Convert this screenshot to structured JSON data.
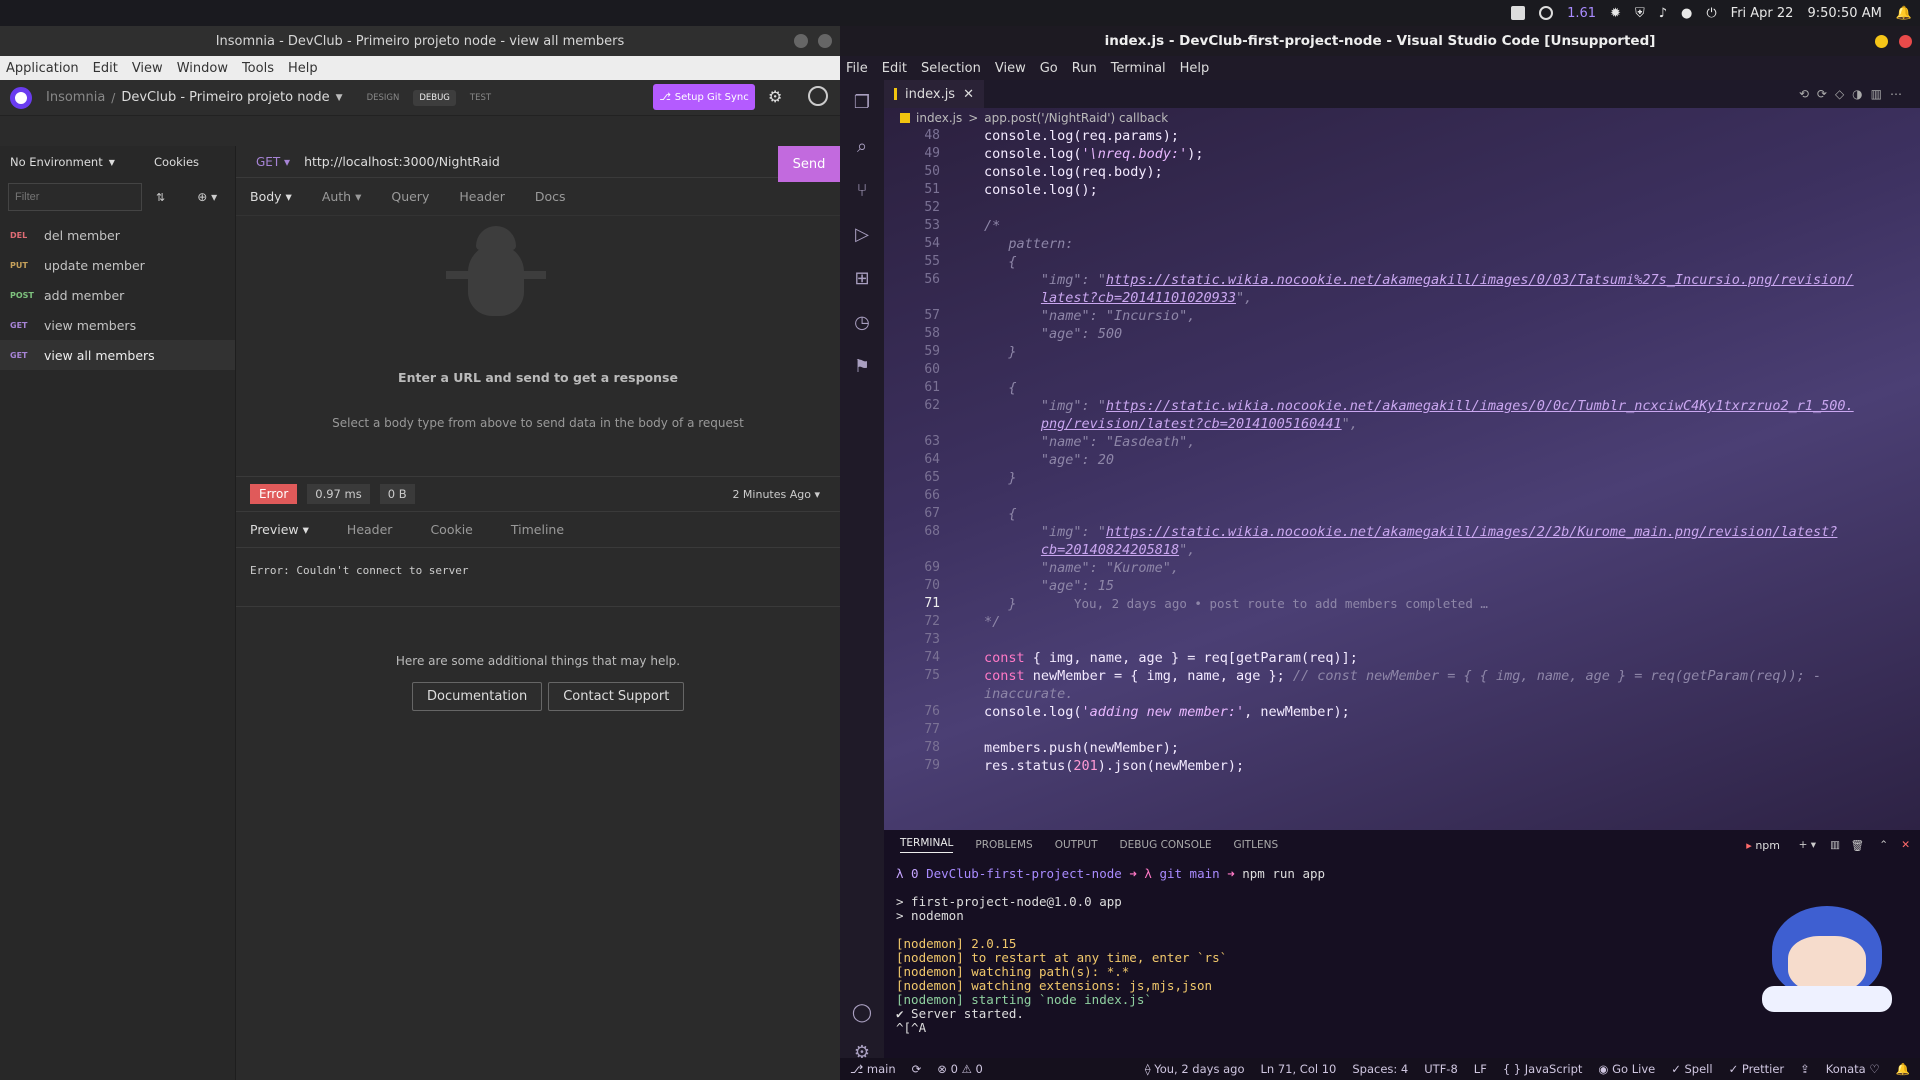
{
  "sysbar": {
    "battery": "1.61",
    "date": "Fri Apr 22",
    "time": "9:50:50 AM"
  },
  "insomnia": {
    "window_title": "Insomnia - DevClub - Primeiro projeto node - view all members",
    "menu": [
      "Application",
      "Edit",
      "View",
      "Window",
      "Tools",
      "Help"
    ],
    "breadcrumb_app": "Insomnia",
    "breadcrumb_sep": "/",
    "breadcrumb_project": "DevClub - Primeiro projeto node",
    "modes": [
      "DESIGN",
      "DEBUG",
      "TEST"
    ],
    "git_sync": "Setup Git Sync",
    "env": "No Environment",
    "cookies": "Cookies",
    "filter_placeholder": "Filter",
    "requests": [
      {
        "method": "DEL",
        "name": "del member"
      },
      {
        "method": "PUT",
        "name": "update member"
      },
      {
        "method": "POST",
        "name": "add member"
      },
      {
        "method": "GET",
        "name": "view members"
      },
      {
        "method": "GET",
        "name": "view all members"
      }
    ],
    "method": "GET",
    "url": "http://localhost:3000/NightRaid",
    "send": "Send",
    "req_tabs": [
      "Body",
      "Auth",
      "Query",
      "Header",
      "Docs"
    ],
    "empty_title": "Enter a URL and send to get a response",
    "empty_sub": "Select a body type from above to send data in the body of a request",
    "status": "Error",
    "time": "0.97 ms",
    "size": "0 B",
    "ago": "2 Minutes Ago",
    "resp_tabs": [
      "Preview",
      "Header",
      "Cookie",
      "Timeline"
    ],
    "error": "Error: Couldn't connect to server",
    "help": "Here are some additional things that may help.",
    "doc_btn": "Documentation",
    "support_btn": "Contact Support"
  },
  "vscode": {
    "window_title": "index.js - DevClub-first-project-node - Visual Studio Code [Unsupported]",
    "menu": [
      "File",
      "Edit",
      "Selection",
      "View",
      "Go",
      "Run",
      "Terminal",
      "Help"
    ],
    "tab": "index.js",
    "crumb_file": "index.js",
    "crumb_sep": ">",
    "crumb_fn": "app.post('/NightRaid') callback",
    "blame": "You, 2 days ago • post route to add members completed …",
    "panel_tabs": [
      "TERMINAL",
      "PROBLEMS",
      "OUTPUT",
      "DEBUG CONSOLE",
      "GITLENS"
    ],
    "term_name": "npm",
    "terminal": {
      "prompt_sym": "λ 0",
      "prompt_dir": "DevClub-first-project-node",
      "arrow1": "➜",
      "lam": "λ",
      "git": "git",
      "branch": "main",
      "arrow2": "➜",
      "cmd": "npm run app",
      "l1": "> first-project-node@1.0.0 app",
      "l2": "> nodemon",
      "l3": "[nodemon] 2.0.15",
      "l4": "[nodemon] to restart at any time, enter `rs`",
      "l5": "[nodemon] watching path(s): *.*",
      "l6": "[nodemon] watching extensions: js,mjs,json",
      "l7": "[nodemon] starting `node index.js`",
      "l8": "✔ Server started.",
      "l9": "^[^A"
    },
    "status": {
      "branch": "main",
      "errors": "0",
      "warnings": "0",
      "blame": "You, 2 days ago",
      "pos": "Ln 71, Col 10",
      "spaces": "Spaces: 4",
      "enc": "UTF-8",
      "eol": "LF",
      "lang": "{ } JavaScript",
      "golive": "Go Live",
      "spell": "✓ Spell",
      "prettier": "✓ Prettier",
      "theme": "Konata ♡"
    }
  }
}
